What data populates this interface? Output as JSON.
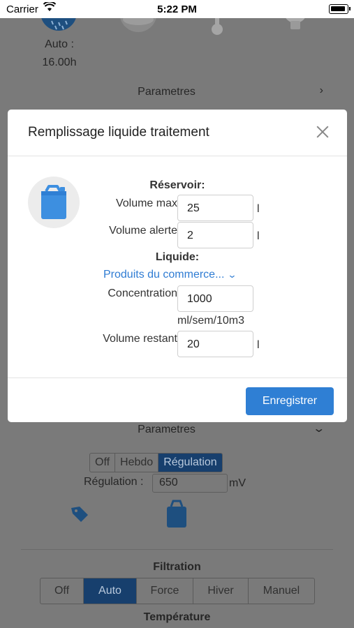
{
  "statusbar": {
    "carrier": "Carrier",
    "time": "5:22 PM"
  },
  "background": {
    "auto_label_1": "Auto :",
    "auto_label_2": "16.00h",
    "parametres_top": "Parametres",
    "parametres_mid": "Parametres",
    "mode_segment": {
      "options": [
        "Off",
        "Hebdo",
        "Régulation"
      ],
      "selected": "Régulation"
    },
    "regulation_label": "Régulation :",
    "regulation_value": "650",
    "regulation_unit": "mV",
    "filtration_title": "Filtration",
    "filtration_segment": {
      "options": [
        "Off",
        "Auto",
        "Force",
        "Hiver",
        "Manuel"
      ],
      "selected": "Auto"
    },
    "temperature_title": "Température"
  },
  "modal": {
    "title": "Remplissage liquide traitement",
    "reservoir_heading": "Réservoir:",
    "volume_max_label": "Volume max",
    "volume_max_value": "25",
    "volume_max_unit": "l",
    "volume_alerte_label": "Volume alerte",
    "volume_alerte_value": "2",
    "volume_alerte_unit": "l",
    "liquide_heading": "Liquide:",
    "liquide_select": "Produits du commerce...",
    "concentration_label": "Concentration",
    "concentration_value": "1000",
    "concentration_unit": "ml/sem/10m3",
    "volume_restant_label": "Volume restant",
    "volume_restant_value": "20",
    "volume_restant_unit": "l",
    "save_label": "Enregistrer"
  },
  "colors": {
    "accent": "#2f7fd4",
    "jerrycan": "#3d8fe0",
    "overlay": "#7a7a7a"
  },
  "icons": [
    "wifi-icon",
    "battery-icon",
    "water-drops-icon",
    "weather-icon",
    "thermometer-icon",
    "bulb-icon",
    "close-icon",
    "jerrycan-icon",
    "chevron-down-icon",
    "chevron-right-icon",
    "tag-icon"
  ]
}
